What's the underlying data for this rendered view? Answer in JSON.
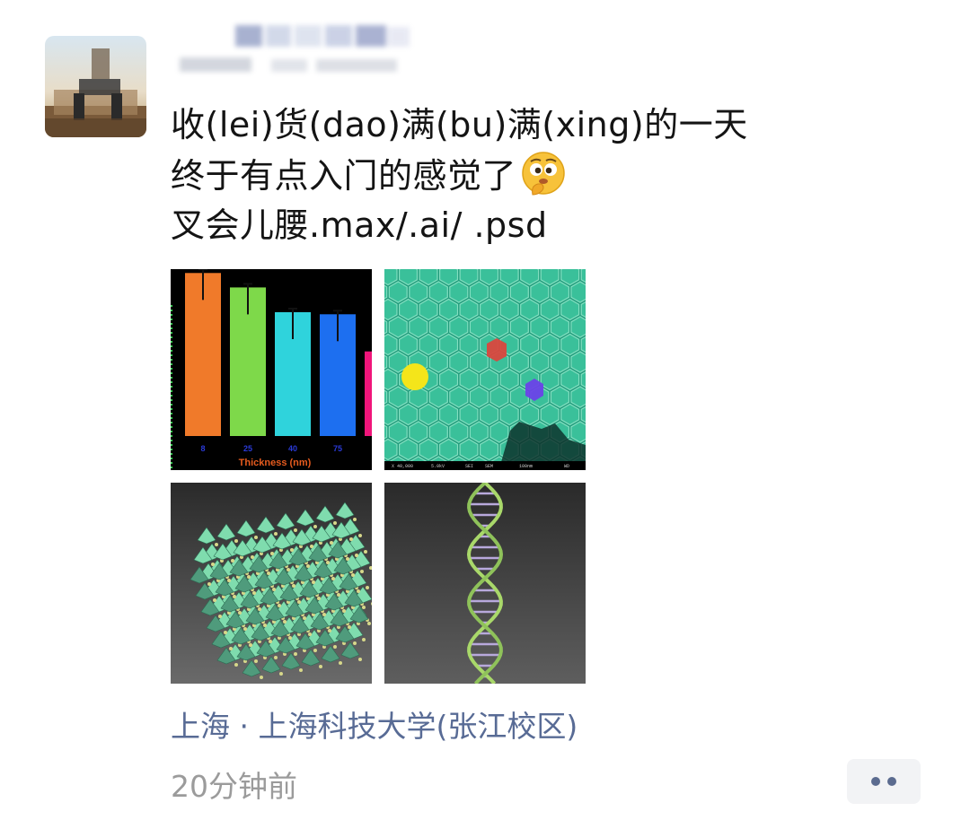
{
  "post": {
    "lines": [
      "收(lei)货(dao)满(bu)满(xing)的一天",
      "终于有点入门的感觉了",
      "叉会儿腰.max/.ai/ .psd"
    ],
    "emoji": "thinking-face-emoji",
    "location": "上海 · 上海科技大学(张江校区)",
    "time": "20分钟前"
  },
  "images": {
    "bar_chart": {
      "axis_label": "Thickness (nm)",
      "tick_labels": [
        "8",
        "25",
        "40",
        "75"
      ]
    },
    "sem_scale_labels": [
      "X 40,000",
      "5.0kV",
      "SEI",
      "SEM",
      "100nm",
      "WD"
    ]
  },
  "chart_data": {
    "type": "bar",
    "categories": [
      "8",
      "25",
      "40",
      "75",
      ""
    ],
    "values": [
      0.79,
      0.72,
      0.6,
      0.59,
      0.41
    ],
    "xlabel": "Thickness (nm)",
    "ylabel": "",
    "colors": [
      "#f07a2a",
      "#7ed94a",
      "#2fd3dc",
      "#1d6ff0",
      "#f0157a"
    ]
  },
  "colors": {
    "text": "#141414",
    "link": "#586b95",
    "time": "#9b9b9b",
    "more_bg": "#f2f3f5",
    "more_dots": "#5b6b8f"
  }
}
